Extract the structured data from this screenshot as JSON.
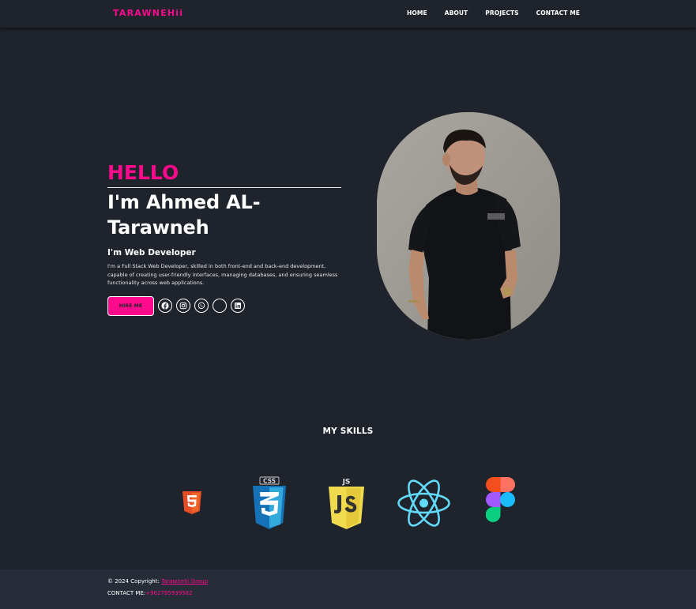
{
  "nav": {
    "brand": "TARAWNEHii",
    "links": [
      "HOME",
      "ABOUT",
      "PROJECTS",
      "CONTACT ME"
    ]
  },
  "hero": {
    "greeting": "HELLO",
    "name": "I'm Ahmed AL-Tarawneh",
    "role": "I'm Web Developer",
    "description": "I'm a Full Stack Web Developer, skilled in both front-end and back-end development, capable of creating user-friendly interfaces, managing databases, and ensuring seamless functionality across web applications.",
    "hire_label": "HIRE ME",
    "socials": [
      "facebook-icon",
      "instagram-icon",
      "whatsapp-icon",
      "github-icon",
      "linkedin-icon"
    ]
  },
  "skills": {
    "title": "MY SKILLS",
    "items": [
      "html5-logo",
      "css3-logo",
      "javascript-logo",
      "react-logo",
      "figma-logo"
    ],
    "css_badge": "CSS",
    "js_badge": "JS"
  },
  "colors": {
    "background": "#1f232c",
    "accent": "#ff0a8c",
    "footer": "#262c38"
  },
  "footer": {
    "copyright_prefix": "© 2024 Copyright:",
    "copyright_link": "Tarawnehi Group",
    "contact_prefix": "CONTACT ME:",
    "contact_phone": "+962795939582"
  }
}
